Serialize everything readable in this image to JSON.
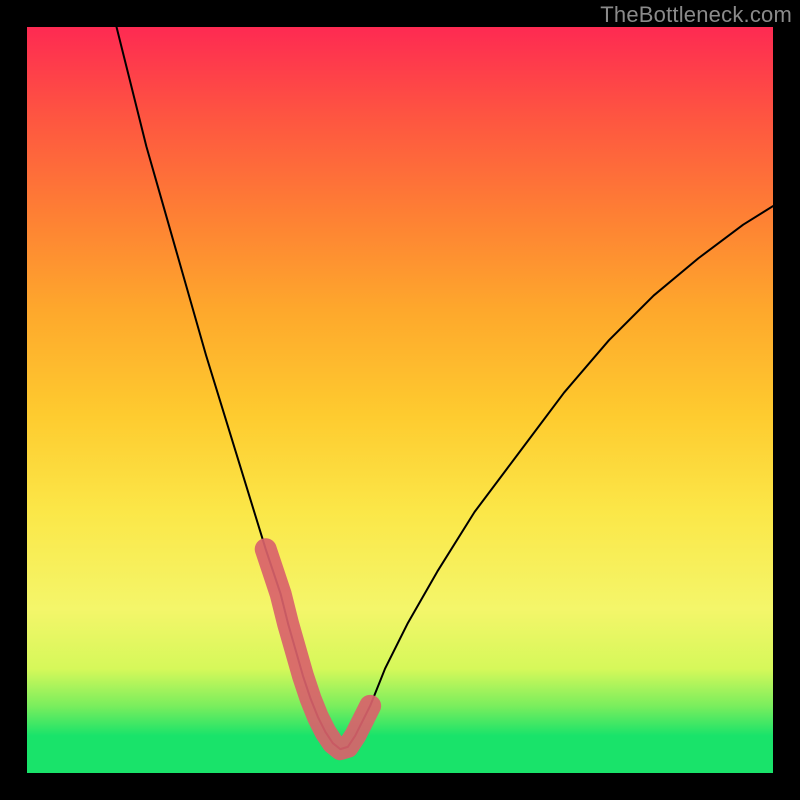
{
  "watermark": "TheBottleneck.com",
  "chart_data": {
    "type": "line",
    "title": "",
    "xlabel": "",
    "ylabel": "",
    "xlim": [
      0,
      100
    ],
    "ylim": [
      0,
      100
    ],
    "background_bands": [
      {
        "y0": 0,
        "y1": 5,
        "color": "#19e36a"
      },
      {
        "y0": 5,
        "y1": 9,
        "color": "#7aee5d"
      },
      {
        "y0": 9,
        "y1": 14,
        "color": "#d6f85a"
      },
      {
        "y0": 14,
        "y1": 22,
        "color": "#f4f66a"
      },
      {
        "y0": 22,
        "y1": 35,
        "color": "#fbe748"
      },
      {
        "y0": 35,
        "y1": 48,
        "color": "#fecb2f"
      },
      {
        "y0": 48,
        "y1": 62,
        "color": "#fea82c"
      },
      {
        "y0": 62,
        "y1": 75,
        "color": "#fe7f34"
      },
      {
        "y0": 75,
        "y1": 88,
        "color": "#fe5541"
      },
      {
        "y0": 88,
        "y1": 100,
        "color": "#fe2a52"
      }
    ],
    "series": [
      {
        "name": "bottleneck-curve",
        "color": "#000000",
        "x": [
          12,
          14,
          16,
          18,
          20,
          22,
          24,
          26,
          28,
          30,
          32,
          34,
          35,
          36,
          37,
          38,
          39,
          40,
          41,
          42,
          43,
          44,
          46,
          48,
          51,
          55,
          60,
          66,
          72,
          78,
          84,
          90,
          96,
          100
        ],
        "y": [
          100,
          92,
          84,
          77,
          70,
          63,
          56,
          49.5,
          43,
          36.5,
          30,
          24,
          20,
          16.5,
          13,
          10,
          7.5,
          5.5,
          4,
          3.2,
          3.5,
          5,
          9,
          14,
          20,
          27,
          35,
          43,
          51,
          58,
          64,
          69,
          73.5,
          76
        ]
      }
    ],
    "highlight": {
      "name": "sweet-spot",
      "color": "#d9626b",
      "x": [
        32,
        33,
        34,
        35,
        36,
        37,
        38,
        39,
        40,
        41,
        42,
        43,
        44,
        45,
        46
      ],
      "y": [
        30,
        27,
        24,
        20,
        16.5,
        13,
        10,
        7.5,
        5.5,
        4,
        3.2,
        3.5,
        5,
        7,
        9
      ]
    }
  }
}
